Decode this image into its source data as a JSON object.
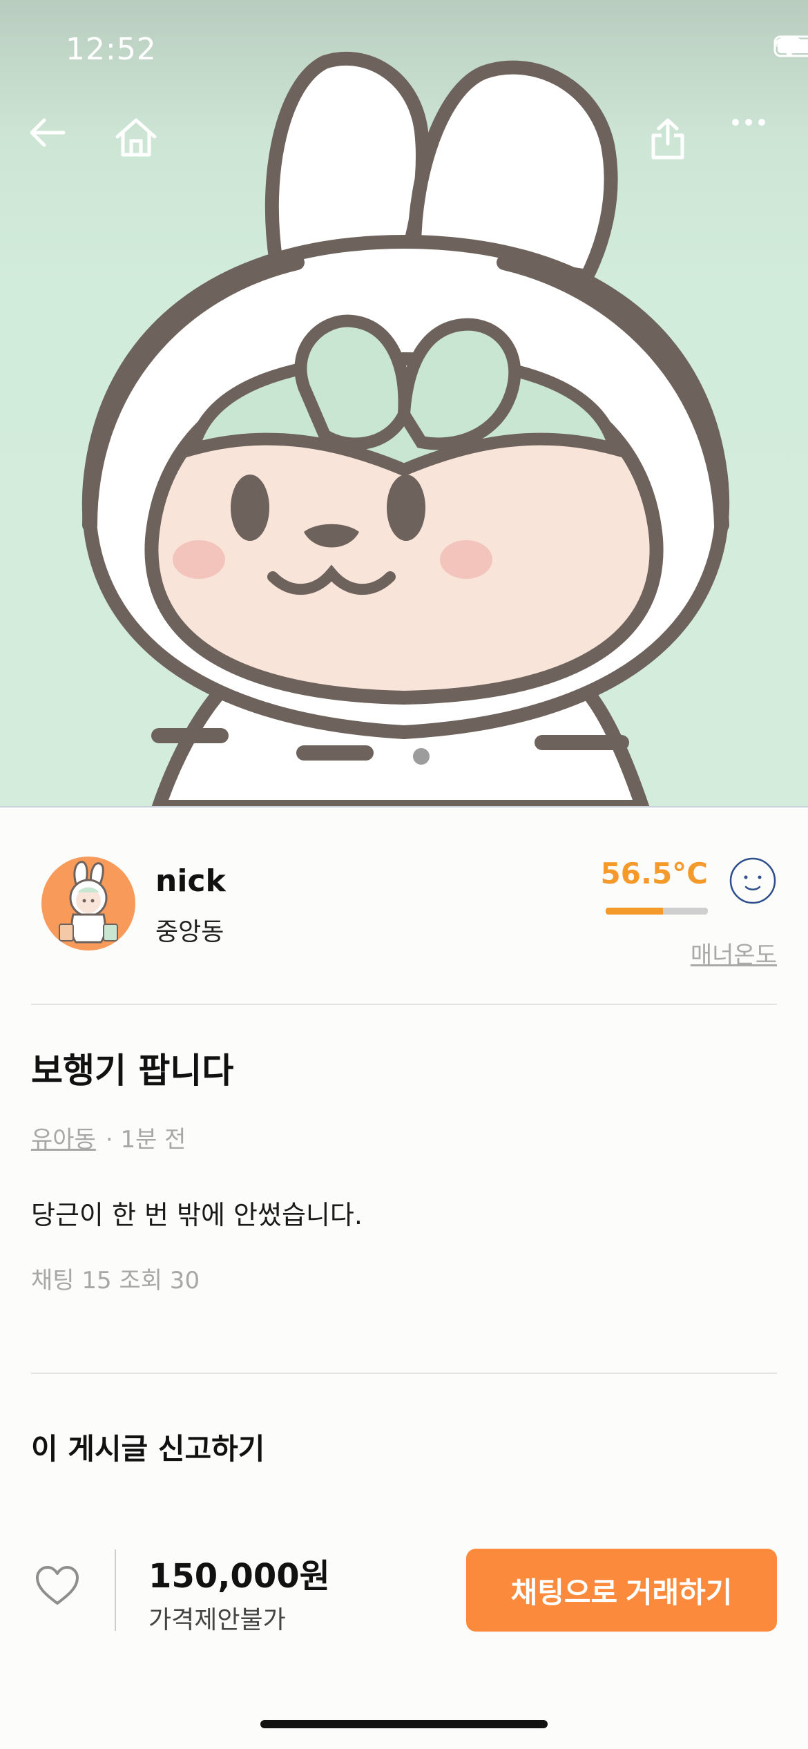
{
  "status_bar": {
    "time": "12:52"
  },
  "seller": {
    "name": "nick",
    "location": "중앙동",
    "temperature": "56.5°C",
    "temperature_level": 0.56,
    "manner_label": "매너온도"
  },
  "post": {
    "title": "보행기 팝니다",
    "category": "유아동",
    "time_ago": "· 1분 전",
    "body": "당근이 한 번 밖에 안썼습니다.",
    "stats": "채팅 15 조회 30",
    "report_label": "이 게시글 신고하기"
  },
  "bottom_bar": {
    "price": "150,000원",
    "price_note": "가격제안불가",
    "chat_button": "채팅으로 거래하기"
  },
  "colors": {
    "accent": "#fb8a3c",
    "temperature": "#f39a2a",
    "hero_bg": "#d4ecdc"
  },
  "icons": {
    "back": "back-arrow-icon",
    "home": "home-icon",
    "share": "share-icon",
    "more": "more-icon",
    "like": "heart-icon",
    "manner_face": "smile-face-icon"
  }
}
